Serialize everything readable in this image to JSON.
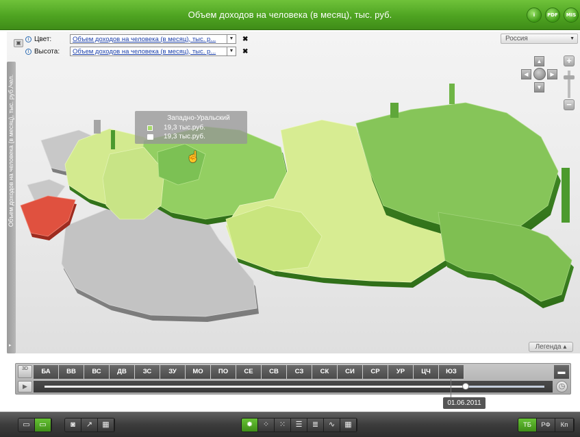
{
  "header": {
    "title": "Объем доходов на человека (в месяц), тыс. руб.",
    "buttons": [
      {
        "label": "i",
        "icon": "info-icon"
      },
      {
        "label": "PDF",
        "icon": "pdf-icon"
      },
      {
        "label": "MIS",
        "icon": "mis-icon"
      }
    ]
  },
  "controls": {
    "color_label": "Цвет:",
    "color_value": "Объем доходов на человека (в месяц), тыс. р...",
    "height_label": "Высота:",
    "height_value": "Объем доходов на человека (в месяц), тыс. р...",
    "remove_symbol": "✖",
    "region_select": "Россия"
  },
  "side_panel": {
    "vertical_label": "Объем доходов на человека (в месяц), тыс. руб./чел."
  },
  "tooltip": {
    "region": "Западно-Уральский",
    "color_value": "19,3 тыс.руб.",
    "height_value": "19,3 тыс.руб."
  },
  "legend_button": "Легенда ▴",
  "timeline": {
    "mode_3d": "3D",
    "region_tabs": [
      "БА",
      "ВВ",
      "ВС",
      "ДВ",
      "ЗС",
      "ЗУ",
      "МО",
      "ПО",
      "СЕ",
      "СВ",
      "СЗ",
      "СК",
      "СИ",
      "СР",
      "УР",
      "ЦЧ",
      "ЮЗ"
    ],
    "current_date": "01.06.2011",
    "progress": 0.84
  },
  "toolbar": {
    "language_buttons": [
      "ТБ",
      "РФ",
      "Кп"
    ],
    "active_language": "ТБ"
  },
  "colors": {
    "brand_green": "#4ea321",
    "highlight_red": "#e0513f",
    "region_gray": "#bdbdbd",
    "region_light_green": "#d3ea8f",
    "region_mid_green": "#a7d96c",
    "region_dark_green": "#7cc154"
  }
}
